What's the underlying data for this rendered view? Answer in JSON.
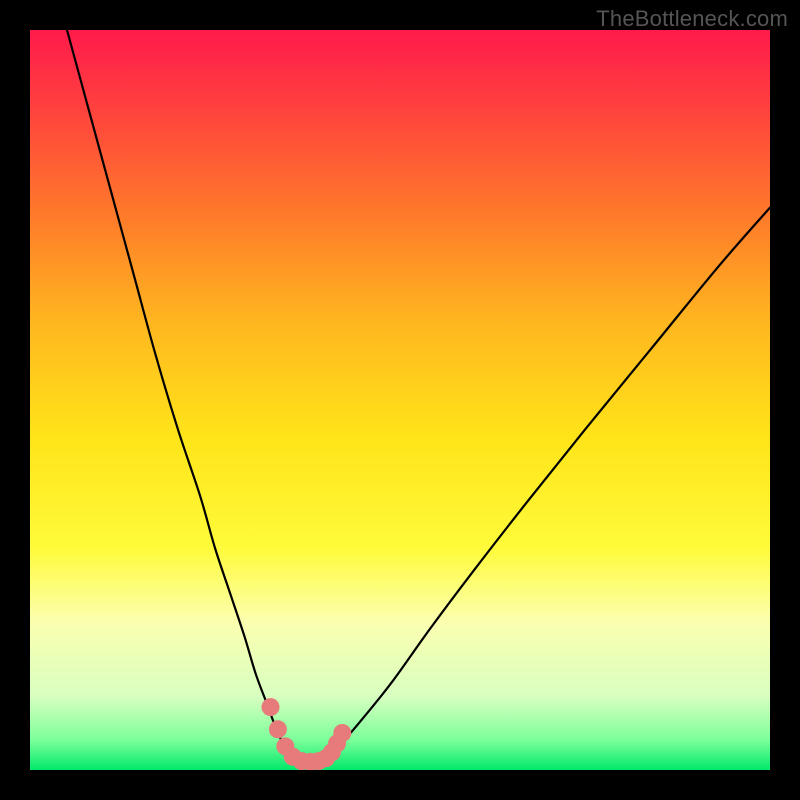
{
  "watermark": "TheBottleneck.com",
  "chart_data": {
    "type": "line",
    "title": "",
    "xlabel": "",
    "ylabel": "",
    "xlim": [
      0,
      100
    ],
    "ylim": [
      0,
      100
    ],
    "background_gradient": {
      "stops": [
        {
          "offset": 0.0,
          "color": "#ff1a4b"
        },
        {
          "offset": 0.1,
          "color": "#ff3f3f"
        },
        {
          "offset": 0.25,
          "color": "#ff7a2a"
        },
        {
          "offset": 0.4,
          "color": "#ffb81f"
        },
        {
          "offset": 0.55,
          "color": "#ffe419"
        },
        {
          "offset": 0.7,
          "color": "#fffb3a"
        },
        {
          "offset": 0.8,
          "color": "#fbffb0"
        },
        {
          "offset": 0.9,
          "color": "#d8ffc0"
        },
        {
          "offset": 0.96,
          "color": "#7bff9a"
        },
        {
          "offset": 1.0,
          "color": "#00e86b"
        }
      ]
    },
    "series": [
      {
        "name": "left-arm",
        "x": [
          5,
          8,
          11,
          14,
          17,
          20,
          23,
          25,
          27,
          29,
          30.5,
          32,
          33.3,
          34.5,
          35.5
        ],
        "y": [
          100,
          89,
          78,
          67,
          56,
          46,
          37,
          30,
          24,
          18,
          13,
          9,
          5.5,
          3,
          1.5
        ]
      },
      {
        "name": "right-arm",
        "x": [
          40,
          42,
          45,
          49,
          54,
          60,
          67,
          75,
          84,
          93,
          100
        ],
        "y": [
          1.5,
          3.5,
          7,
          12,
          19,
          27,
          36,
          46,
          57,
          68,
          76
        ]
      },
      {
        "name": "marker-dots",
        "type": "scatter",
        "color": "#e77b7b",
        "x": [
          32.5,
          33.5,
          34.5,
          35.5,
          36.7,
          37.9,
          39.0,
          40.0,
          40.8,
          41.5,
          42.2
        ],
        "y": [
          8.5,
          5.5,
          3.2,
          1.8,
          1.2,
          1.1,
          1.2,
          1.6,
          2.4,
          3.6,
          5.0
        ]
      }
    ]
  }
}
